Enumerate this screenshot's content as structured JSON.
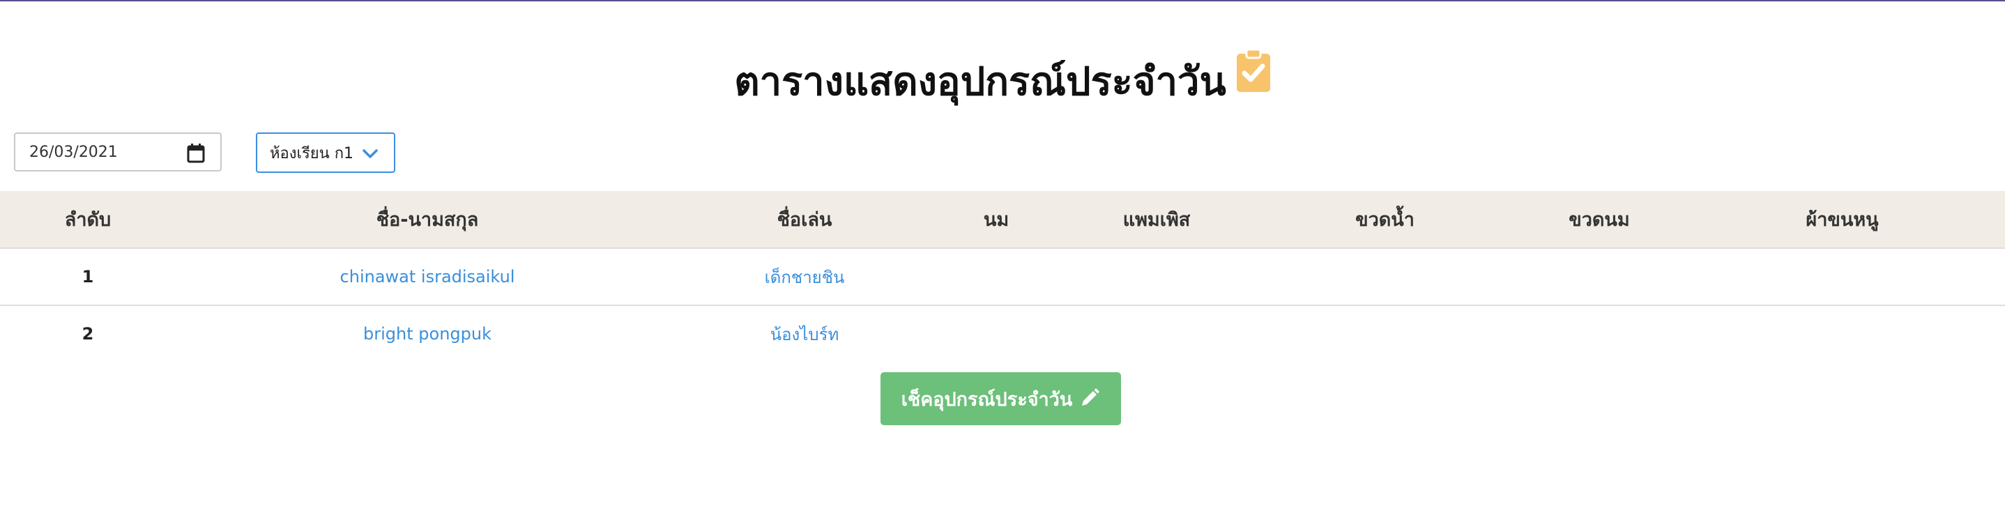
{
  "page": {
    "title": "ตารางแสดงอุปกรณ์ประจำวัน",
    "title_icon": "clipboard-check-icon",
    "accent_colors": {
      "top_line": "#5b4c8e",
      "title_icon": "#f7c46c",
      "button": "#6cc07a",
      "link": "#3a8fdb",
      "header_bg": "#f1ece6"
    }
  },
  "filters": {
    "date_value": "26/03/2021",
    "date_icon": "calendar-icon",
    "class_selected": "ห้องเรียน ก1",
    "class_icon": "chevron-down-icon"
  },
  "table": {
    "headers": [
      "ลำดับ",
      "ชื่อ-นามสกุล",
      "ชื่อเล่น",
      "นม",
      "แพมเพิส",
      "ขวดน้ำ",
      "ขวดนม",
      "ผ้าขนหนู"
    ],
    "rows": [
      {
        "no": "1",
        "fullname": "chinawat isradisaikul",
        "nickname": "เด็กชายชิน"
      },
      {
        "no": "2",
        "fullname": "bright pongpuk",
        "nickname": "น้องไบร์ท"
      }
    ]
  },
  "actions": {
    "check_button_label": "เช็คอุปกรณ์ประจำวัน",
    "check_button_icon": "pencil-icon"
  }
}
